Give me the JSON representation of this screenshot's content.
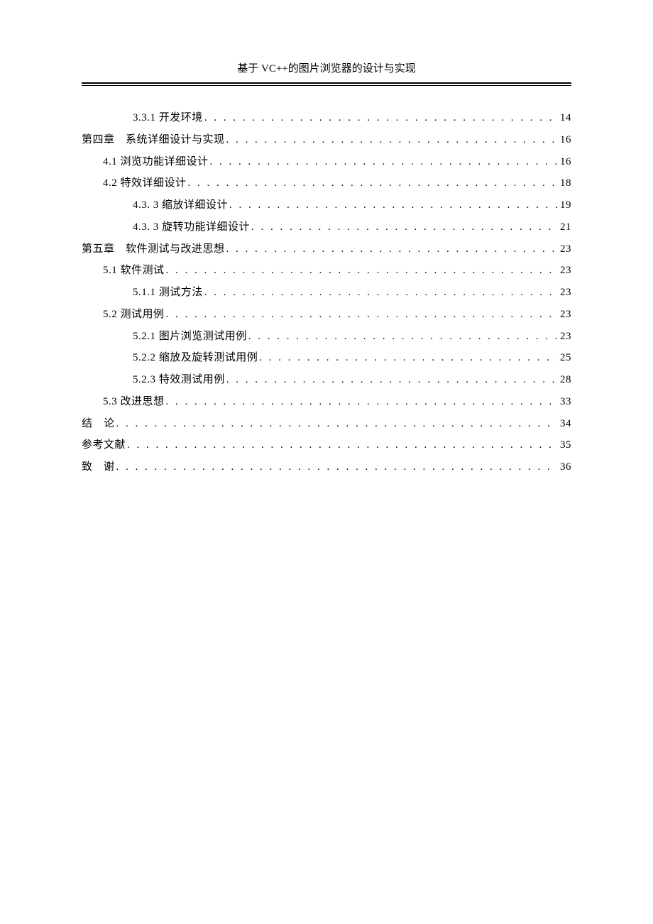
{
  "header": {
    "title": "基于 VC++的图片浏览器的设计与实现"
  },
  "toc": [
    {
      "level": 3,
      "label": "3.3.1 开发环境",
      "page": "14"
    },
    {
      "level": 0,
      "label": "第四章　系统详细设计与实现",
      "page": "16"
    },
    {
      "level": 1,
      "label": "4.1 浏览功能详细设计",
      "page": "16"
    },
    {
      "level": 1,
      "label": "4.2 特效详细设计",
      "page": "18"
    },
    {
      "level": 3,
      "label": "4.3. 3 缩放详细设计",
      "page": "19"
    },
    {
      "level": 3,
      "label": "4.3. 3 旋转功能详细设计",
      "page": "21"
    },
    {
      "level": 0,
      "label": "第五章　软件测试与改进思想",
      "page": "23"
    },
    {
      "level": 1,
      "label": "5.1 软件测试",
      "page": "23"
    },
    {
      "level": 2,
      "label": "5.1.1 测试方法",
      "page": "23"
    },
    {
      "level": 1,
      "label": "5.2 测试用例",
      "page": "23"
    },
    {
      "level": 2,
      "label": "5.2.1 图片浏览测试用例",
      "page": "23"
    },
    {
      "level": 2,
      "label": "5.2.2 缩放及旋转测试用例",
      "page": "25"
    },
    {
      "level": 2,
      "label": "5.2.3 特效测试用例",
      "page": "28"
    },
    {
      "level": 1,
      "label": "5.3 改进思想",
      "page": "33"
    },
    {
      "level": 0,
      "label": "结　论",
      "page": "34"
    },
    {
      "level": 0,
      "label": "参考文献",
      "page": "35"
    },
    {
      "level": 0,
      "label": "致　谢",
      "page": "36"
    }
  ]
}
